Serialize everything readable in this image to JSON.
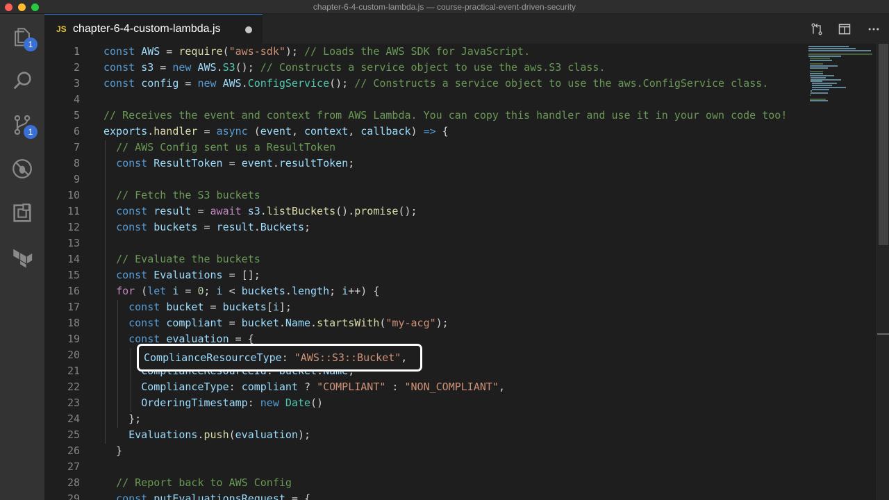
{
  "window": {
    "title": "chapter-6-4-custom-lambda.js — course-practical-event-driven-security"
  },
  "activity_bar": {
    "items": [
      {
        "icon": "files-icon",
        "badge": "1"
      },
      {
        "icon": "search-icon",
        "badge": ""
      },
      {
        "icon": "source-control-icon",
        "badge": "1"
      },
      {
        "icon": "debug-icon",
        "badge": ""
      },
      {
        "icon": "extensions-icon",
        "badge": ""
      },
      {
        "icon": "terraform-icon",
        "badge": ""
      }
    ]
  },
  "tabs": [
    {
      "badge": "JS",
      "label": "chapter-6-4-custom-lambda.js",
      "dirty": true,
      "active": true
    }
  ],
  "toolbar": {
    "icons": [
      "open-changes-icon",
      "split-editor-icon",
      "more-actions-icon"
    ]
  },
  "editor": {
    "lines": [
      {
        "n": "1",
        "tokens": [
          [
            "kw",
            "const"
          ],
          [
            "p",
            " "
          ],
          [
            "vr",
            "AWS"
          ],
          [
            "p",
            " = "
          ],
          [
            "fn",
            "require"
          ],
          [
            "p",
            "("
          ],
          [
            "str",
            "\"aws-sdk\""
          ],
          [
            "p",
            ");"
          ],
          [
            "p",
            " "
          ],
          [
            "cmt",
            "// Loads the AWS SDK for JavaScript."
          ]
        ]
      },
      {
        "n": "2",
        "tokens": [
          [
            "kw",
            "const"
          ],
          [
            "p",
            " "
          ],
          [
            "vr",
            "s3"
          ],
          [
            "p",
            " = "
          ],
          [
            "kw",
            "new"
          ],
          [
            "p",
            " "
          ],
          [
            "vr",
            "AWS"
          ],
          [
            "p",
            "."
          ],
          [
            "cls",
            "S3"
          ],
          [
            "p",
            "();"
          ],
          [
            "p",
            " "
          ],
          [
            "cmt",
            "// Constructs a service object to use the aws.S3 class."
          ]
        ]
      },
      {
        "n": "3",
        "tokens": [
          [
            "kw",
            "const"
          ],
          [
            "p",
            " "
          ],
          [
            "vr",
            "config"
          ],
          [
            "p",
            " = "
          ],
          [
            "kw",
            "new"
          ],
          [
            "p",
            " "
          ],
          [
            "vr",
            "AWS"
          ],
          [
            "p",
            "."
          ],
          [
            "cls",
            "ConfigService"
          ],
          [
            "p",
            "();"
          ],
          [
            "p",
            " "
          ],
          [
            "cmt",
            "// Constructs a service object to use the aws.ConfigService class."
          ]
        ]
      },
      {
        "n": "4",
        "tokens": []
      },
      {
        "n": "5",
        "tokens": [
          [
            "cmt",
            "// Receives the event and context from AWS Lambda. You can copy this handler and use it in your own code too!"
          ]
        ]
      },
      {
        "n": "6",
        "tokens": [
          [
            "vr",
            "exports"
          ],
          [
            "p",
            "."
          ],
          [
            "fn",
            "handler"
          ],
          [
            "p",
            " = "
          ],
          [
            "kw",
            "async"
          ],
          [
            "p",
            " ("
          ],
          [
            "vr",
            "event"
          ],
          [
            "p",
            ", "
          ],
          [
            "vr",
            "context"
          ],
          [
            "p",
            ", "
          ],
          [
            "vr",
            "callback"
          ],
          [
            "p",
            ") "
          ],
          [
            "kw",
            "=>"
          ],
          [
            "p",
            " {"
          ]
        ]
      },
      {
        "n": "7",
        "tokens": [
          [
            "p",
            "  "
          ],
          [
            "cmt",
            "// AWS Config sent us a ResultToken"
          ]
        ]
      },
      {
        "n": "8",
        "tokens": [
          [
            "p",
            "  "
          ],
          [
            "kw",
            "const"
          ],
          [
            "p",
            " "
          ],
          [
            "vr",
            "ResultToken"
          ],
          [
            "p",
            " = "
          ],
          [
            "vr",
            "event"
          ],
          [
            "p",
            "."
          ],
          [
            "vr",
            "resultToken"
          ],
          [
            "p",
            ";"
          ]
        ]
      },
      {
        "n": "9",
        "tokens": []
      },
      {
        "n": "10",
        "tokens": [
          [
            "p",
            "  "
          ],
          [
            "cmt",
            "// Fetch the S3 buckets"
          ]
        ]
      },
      {
        "n": "11",
        "tokens": [
          [
            "p",
            "  "
          ],
          [
            "kw",
            "const"
          ],
          [
            "p",
            " "
          ],
          [
            "vr",
            "result"
          ],
          [
            "p",
            " = "
          ],
          [
            "ctl",
            "await"
          ],
          [
            "p",
            " "
          ],
          [
            "vr",
            "s3"
          ],
          [
            "p",
            "."
          ],
          [
            "fn",
            "listBuckets"
          ],
          [
            "p",
            "()."
          ],
          [
            "fn",
            "promise"
          ],
          [
            "p",
            "();"
          ]
        ]
      },
      {
        "n": "12",
        "tokens": [
          [
            "p",
            "  "
          ],
          [
            "kw",
            "const"
          ],
          [
            "p",
            " "
          ],
          [
            "vr",
            "buckets"
          ],
          [
            "p",
            " = "
          ],
          [
            "vr",
            "result"
          ],
          [
            "p",
            "."
          ],
          [
            "vr",
            "Buckets"
          ],
          [
            "p",
            ";"
          ]
        ]
      },
      {
        "n": "13",
        "tokens": []
      },
      {
        "n": "14",
        "tokens": [
          [
            "p",
            "  "
          ],
          [
            "cmt",
            "// Evaluate the buckets"
          ]
        ]
      },
      {
        "n": "15",
        "tokens": [
          [
            "p",
            "  "
          ],
          [
            "kw",
            "const"
          ],
          [
            "p",
            " "
          ],
          [
            "vr",
            "Evaluations"
          ],
          [
            "p",
            " = [];"
          ]
        ]
      },
      {
        "n": "16",
        "tokens": [
          [
            "p",
            "  "
          ],
          [
            "ctl",
            "for"
          ],
          [
            "p",
            " ("
          ],
          [
            "kw",
            "let"
          ],
          [
            "p",
            " "
          ],
          [
            "vr",
            "i"
          ],
          [
            "p",
            " = "
          ],
          [
            "num",
            "0"
          ],
          [
            "p",
            "; "
          ],
          [
            "vr",
            "i"
          ],
          [
            "p",
            " < "
          ],
          [
            "vr",
            "buckets"
          ],
          [
            "p",
            "."
          ],
          [
            "vr",
            "length"
          ],
          [
            "p",
            "; "
          ],
          [
            "vr",
            "i"
          ],
          [
            "p",
            "++) {"
          ]
        ]
      },
      {
        "n": "17",
        "tokens": [
          [
            "p",
            "    "
          ],
          [
            "kw",
            "const"
          ],
          [
            "p",
            " "
          ],
          [
            "vr",
            "bucket"
          ],
          [
            "p",
            " = "
          ],
          [
            "vr",
            "buckets"
          ],
          [
            "p",
            "["
          ],
          [
            "vr",
            "i"
          ],
          [
            "p",
            "];"
          ]
        ]
      },
      {
        "n": "18",
        "tokens": [
          [
            "p",
            "    "
          ],
          [
            "kw",
            "const"
          ],
          [
            "p",
            " "
          ],
          [
            "vr",
            "compliant"
          ],
          [
            "p",
            " = "
          ],
          [
            "vr",
            "bucket"
          ],
          [
            "p",
            "."
          ],
          [
            "vr",
            "Name"
          ],
          [
            "p",
            "."
          ],
          [
            "fn",
            "startsWith"
          ],
          [
            "p",
            "("
          ],
          [
            "str",
            "\"my-acg\""
          ],
          [
            "p",
            ");"
          ]
        ]
      },
      {
        "n": "19",
        "tokens": [
          [
            "p",
            "    "
          ],
          [
            "kw",
            "const"
          ],
          [
            "p",
            " "
          ],
          [
            "vr",
            "evaluation"
          ],
          [
            "p",
            " = {"
          ]
        ]
      },
      {
        "n": "20",
        "tokens": [
          [
            "p",
            "      "
          ],
          [
            "vr",
            "ComplianceResourceType"
          ],
          [
            "p",
            ": "
          ],
          [
            "str",
            "\"AWS::S3::Bucket\""
          ],
          [
            "p",
            ","
          ]
        ]
      },
      {
        "n": "21",
        "tokens": [
          [
            "p",
            "      "
          ],
          [
            "vr",
            "ComplianceResourceId"
          ],
          [
            "p",
            ": "
          ],
          [
            "vr",
            "bucket"
          ],
          [
            "p",
            "."
          ],
          [
            "vr",
            "Name"
          ],
          [
            "p",
            ","
          ]
        ]
      },
      {
        "n": "22",
        "tokens": [
          [
            "p",
            "      "
          ],
          [
            "vr",
            "ComplianceType"
          ],
          [
            "p",
            ": "
          ],
          [
            "vr",
            "compliant"
          ],
          [
            "p",
            " ? "
          ],
          [
            "str",
            "\"COMPLIANT\""
          ],
          [
            "p",
            " : "
          ],
          [
            "str",
            "\"NON_COMPLIANT\""
          ],
          [
            "p",
            ","
          ]
        ]
      },
      {
        "n": "23",
        "tokens": [
          [
            "p",
            "      "
          ],
          [
            "vr",
            "OrderingTimestamp"
          ],
          [
            "p",
            ": "
          ],
          [
            "kw",
            "new"
          ],
          [
            "p",
            " "
          ],
          [
            "cls",
            "Date"
          ],
          [
            "p",
            "()"
          ]
        ]
      },
      {
        "n": "24",
        "tokens": [
          [
            "p",
            "    };"
          ]
        ]
      },
      {
        "n": "25",
        "tokens": [
          [
            "p",
            "    "
          ],
          [
            "vr",
            "Evaluations"
          ],
          [
            "p",
            "."
          ],
          [
            "fn",
            "push"
          ],
          [
            "p",
            "("
          ],
          [
            "vr",
            "evaluation"
          ],
          [
            "p",
            ");"
          ]
        ]
      },
      {
        "n": "26",
        "tokens": [
          [
            "p",
            "  }"
          ]
        ]
      },
      {
        "n": "27",
        "tokens": []
      },
      {
        "n": "28",
        "tokens": [
          [
            "p",
            "  "
          ],
          [
            "cmt",
            "// Report back to AWS Config"
          ]
        ]
      },
      {
        "n": "29",
        "tokens": [
          [
            "p",
            "  "
          ],
          [
            "kw",
            "const"
          ],
          [
            "p",
            " "
          ],
          [
            "vr",
            "putEvaluationsRequest"
          ],
          [
            "p",
            " = {"
          ]
        ]
      }
    ],
    "highlight": {
      "tokens": [
        [
          "vr",
          "ComplianceResourceType"
        ],
        [
          "p",
          ": "
        ],
        [
          "str",
          "\"AWS::S3::Bucket\""
        ],
        [
          "p",
          ","
        ]
      ]
    }
  },
  "colors": {
    "keyword": "#569cd6",
    "variable": "#9cdcfe",
    "function": "#dcdcaa",
    "class": "#4ec9b0",
    "string": "#ce9178",
    "comment": "#6a9955",
    "number": "#b5cea8",
    "control": "#c586c0"
  }
}
